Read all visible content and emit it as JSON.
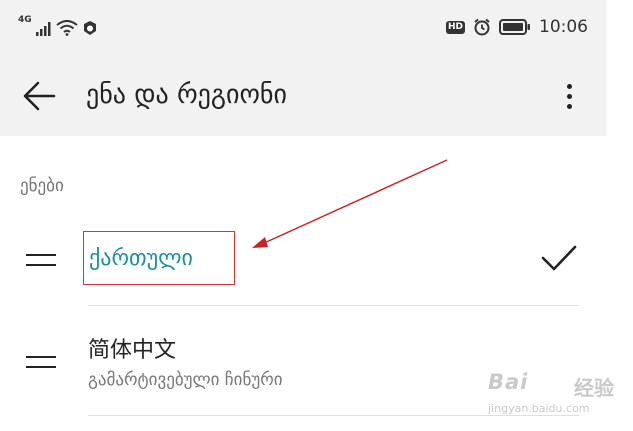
{
  "status_bar": {
    "network": "4G",
    "hd": "HD",
    "time": "10:06",
    "icons": [
      "signal-icon",
      "wifi-icon",
      "notification-icon",
      "alarm-icon",
      "battery-icon"
    ]
  },
  "app_bar": {
    "title": "ენა და რეგიონი",
    "back_icon": "back-arrow-icon",
    "more_icon": "more-vertical-icon"
  },
  "section": {
    "label": "ენები"
  },
  "languages": [
    {
      "title": "ქართული",
      "selected": true,
      "icon": "drag-handle-icon"
    },
    {
      "title": "简体中文",
      "subtitle": "გამარტივებული ჩინური",
      "selected": false,
      "icon": "drag-handle-icon"
    }
  ],
  "annotation": {
    "box_color": "#dd3333",
    "arrow_color": "#cc2222"
  },
  "colors": {
    "accent": "#1a8fa0",
    "app_bar_bg": "#f2f2f2",
    "content_bg": "#ffffff"
  },
  "watermark": {
    "logo": "Bai",
    "cn": "经验",
    "url": "jingyan.baidu.com"
  }
}
